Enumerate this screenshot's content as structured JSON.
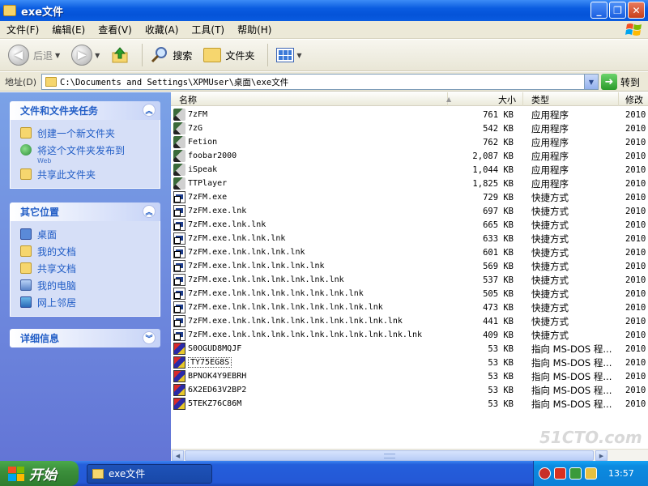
{
  "window": {
    "title": "exe文件"
  },
  "menu": [
    "文件(F)",
    "编辑(E)",
    "查看(V)",
    "收藏(A)",
    "工具(T)",
    "帮助(H)"
  ],
  "toolbar": {
    "back": "后退",
    "search": "搜索",
    "folders": "文件夹"
  },
  "address": {
    "label": "地址(D)",
    "path": "C:\\Documents and Settings\\XPMUser\\桌面\\exe文件",
    "go": "转到"
  },
  "tasks": {
    "title": "文件和文件夹任务",
    "items": [
      {
        "label": "创建一个新文件夹",
        "icon": "new-folder-icon"
      },
      {
        "label": "将这个文件夹发布到",
        "sub": "Web",
        "icon": "publish-web-icon"
      },
      {
        "label": "共享此文件夹",
        "icon": "share-folder-icon"
      }
    ]
  },
  "places": {
    "title": "其它位置",
    "items": [
      {
        "label": "桌面",
        "icon": "desktop-icon"
      },
      {
        "label": "我的文档",
        "icon": "my-documents-icon"
      },
      {
        "label": "共享文档",
        "icon": "shared-documents-icon"
      },
      {
        "label": "我的电脑",
        "icon": "my-computer-icon"
      },
      {
        "label": "网上邻居",
        "icon": "network-places-icon"
      }
    ]
  },
  "details": {
    "title": "详细信息"
  },
  "columns": {
    "name": "名称",
    "size": "大小",
    "type": "类型",
    "date": "修改"
  },
  "files": [
    {
      "name": "7zFM",
      "size": "761 KB",
      "type": "应用程序",
      "date": "2010",
      "kind": "app"
    },
    {
      "name": "7zG",
      "size": "542 KB",
      "type": "应用程序",
      "date": "2010",
      "kind": "app"
    },
    {
      "name": "Fetion",
      "size": "762 KB",
      "type": "应用程序",
      "date": "2010",
      "kind": "app"
    },
    {
      "name": "foobar2000",
      "size": "2,087 KB",
      "type": "应用程序",
      "date": "2010",
      "kind": "app"
    },
    {
      "name": "iSpeak",
      "size": "1,044 KB",
      "type": "应用程序",
      "date": "2010",
      "kind": "app"
    },
    {
      "name": "TTPlayer",
      "size": "1,825 KB",
      "type": "应用程序",
      "date": "2010",
      "kind": "app"
    },
    {
      "name": "7zFM.exe",
      "size": "729 KB",
      "type": "快捷方式",
      "date": "2010",
      "kind": "lnk"
    },
    {
      "name": "7zFM.exe.lnk",
      "size": "697 KB",
      "type": "快捷方式",
      "date": "2010",
      "kind": "lnk"
    },
    {
      "name": "7zFM.exe.lnk.lnk",
      "size": "665 KB",
      "type": "快捷方式",
      "date": "2010",
      "kind": "lnk"
    },
    {
      "name": "7zFM.exe.lnk.lnk.lnk",
      "size": "633 KB",
      "type": "快捷方式",
      "date": "2010",
      "kind": "lnk"
    },
    {
      "name": "7zFM.exe.lnk.lnk.lnk.lnk",
      "size": "601 KB",
      "type": "快捷方式",
      "date": "2010",
      "kind": "lnk"
    },
    {
      "name": "7zFM.exe.lnk.lnk.lnk.lnk.lnk",
      "size": "569 KB",
      "type": "快捷方式",
      "date": "2010",
      "kind": "lnk"
    },
    {
      "name": "7zFM.exe.lnk.lnk.lnk.lnk.lnk.lnk",
      "size": "537 KB",
      "type": "快捷方式",
      "date": "2010",
      "kind": "lnk"
    },
    {
      "name": "7zFM.exe.lnk.lnk.lnk.lnk.lnk.lnk.lnk",
      "size": "505 KB",
      "type": "快捷方式",
      "date": "2010",
      "kind": "lnk"
    },
    {
      "name": "7zFM.exe.lnk.lnk.lnk.lnk.lnk.lnk.lnk.lnk",
      "size": "473 KB",
      "type": "快捷方式",
      "date": "2010",
      "kind": "lnk"
    },
    {
      "name": "7zFM.exe.lnk.lnk.lnk.lnk.lnk.lnk.lnk.lnk.lnk",
      "size": "441 KB",
      "type": "快捷方式",
      "date": "2010",
      "kind": "lnk"
    },
    {
      "name": "7zFM.exe.lnk.lnk.lnk.lnk.lnk.lnk.lnk.lnk.lnk.lnk",
      "size": "409 KB",
      "type": "快捷方式",
      "date": "2010",
      "kind": "lnk"
    },
    {
      "name": "S0OGUD8MQJF",
      "size": "53 KB",
      "type": "指向 MS-DOS 程...",
      "date": "2010",
      "kind": "pif"
    },
    {
      "name": "TY75EG8S",
      "size": "53 KB",
      "type": "指向 MS-DOS 程...",
      "date": "2010",
      "kind": "pif",
      "focused": true
    },
    {
      "name": "BPNOK4Y9EBRH",
      "size": "53 KB",
      "type": "指向 MS-DOS 程...",
      "date": "2010",
      "kind": "pif"
    },
    {
      "name": "6X2ED63V2BP2",
      "size": "53 KB",
      "type": "指向 MS-DOS 程...",
      "date": "2010",
      "kind": "pif"
    },
    {
      "name": "5TEKZ76C86M",
      "size": "53 KB",
      "type": "指向 MS-DOS 程...",
      "date": "2010",
      "kind": "pif"
    }
  ],
  "taskbar": {
    "start": "开始",
    "window": "exe文件",
    "clock": "13:57"
  },
  "watermark": "51CTO.com"
}
